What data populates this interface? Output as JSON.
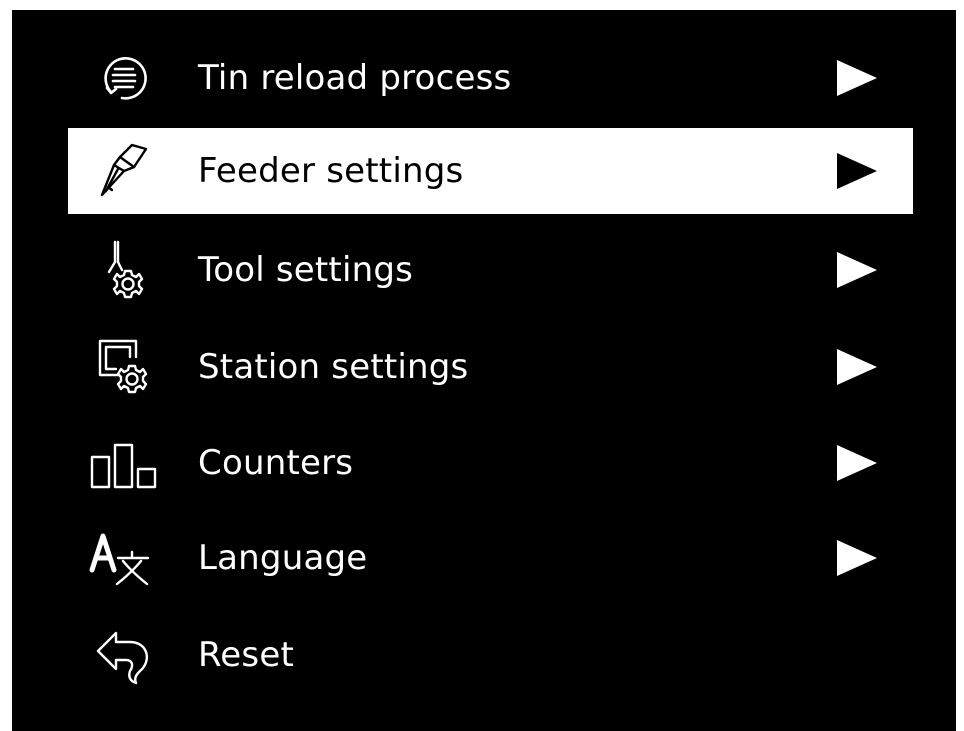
{
  "menu": {
    "selected_index": 1,
    "items": [
      {
        "label": "Tin reload process",
        "icon": "tin-reload-icon",
        "has_submenu": true
      },
      {
        "label": "Feeder settings",
        "icon": "feeder-icon",
        "has_submenu": true
      },
      {
        "label": "Tool settings",
        "icon": "tool-settings-icon",
        "has_submenu": true
      },
      {
        "label": "Station settings",
        "icon": "station-settings-icon",
        "has_submenu": true
      },
      {
        "label": "Counters",
        "icon": "counters-icon",
        "has_submenu": true
      },
      {
        "label": "Language",
        "icon": "language-icon",
        "has_submenu": true
      },
      {
        "label": "Reset",
        "icon": "reset-icon",
        "has_submenu": false
      }
    ]
  },
  "colors": {
    "background": "#000000",
    "foreground": "#ffffff",
    "selected_background": "#ffffff",
    "selected_foreground": "#000000"
  }
}
